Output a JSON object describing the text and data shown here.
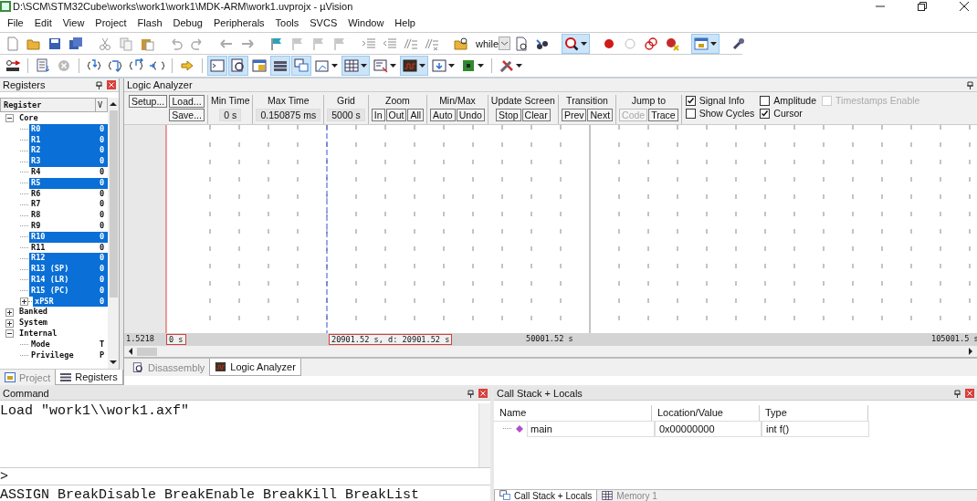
{
  "window": {
    "title": "D:\\SCM\\STM32Cube\\works\\work1\\work1\\MDK-ARM\\work1.uvprojx - µVision"
  },
  "menu": [
    "File",
    "Edit",
    "View",
    "Project",
    "Flash",
    "Debug",
    "Peripherals",
    "Tools",
    "SVCS",
    "Window",
    "Help"
  ],
  "toolbar_1": [
    {
      "kind": "new-file",
      "pressed": false
    },
    {
      "kind": "open",
      "pressed": false
    },
    {
      "kind": "save",
      "pressed": false
    },
    {
      "kind": "save-all",
      "pressed": false
    },
    {
      "kind": "separator"
    },
    {
      "kind": "cut",
      "pressed": false
    },
    {
      "kind": "copy",
      "pressed": false
    },
    {
      "kind": "paste",
      "pressed": false
    },
    {
      "kind": "separator"
    },
    {
      "kind": "undo",
      "pressed": false
    },
    {
      "kind": "redo",
      "pressed": false
    },
    {
      "kind": "separator"
    },
    {
      "kind": "back",
      "pressed": false
    },
    {
      "kind": "forward",
      "pressed": false
    },
    {
      "kind": "separator"
    },
    {
      "kind": "bookmark",
      "pressed": false
    },
    {
      "kind": "bookmark-grey",
      "pressed": false
    },
    {
      "kind": "bookmark-grey",
      "pressed": false
    },
    {
      "kind": "bookmark-grey",
      "pressed": false
    },
    {
      "kind": "separator"
    },
    {
      "kind": "indent",
      "pressed": false
    },
    {
      "kind": "unindent",
      "pressed": false
    },
    {
      "kind": "comment",
      "pressed": false
    },
    {
      "kind": "uncomment",
      "pressed": false
    },
    {
      "kind": "separator"
    },
    {
      "kind": "find-folder",
      "pressed": false
    },
    {
      "kind": "search-box",
      "value": "while"
    },
    {
      "kind": "find-doc",
      "pressed": false
    },
    {
      "kind": "find-binoculars",
      "pressed": false
    },
    {
      "kind": "separator"
    },
    {
      "kind": "debug",
      "pressed": true,
      "dropdown": true
    },
    {
      "kind": "separator"
    },
    {
      "kind": "breakpoint",
      "pressed": false
    },
    {
      "kind": "breakpoint-empty",
      "pressed": false
    },
    {
      "kind": "breakpoint-multi",
      "pressed": false
    },
    {
      "kind": "breakpoint-kill",
      "pressed": false
    },
    {
      "kind": "separator"
    },
    {
      "kind": "window",
      "pressed": true,
      "dropdown": true
    },
    {
      "kind": "separator"
    },
    {
      "kind": "wrench",
      "pressed": false
    }
  ],
  "toolbar_2": [
    {
      "kind": "reset",
      "pressed": false
    },
    {
      "kind": "separator"
    },
    {
      "kind": "run",
      "pressed": false
    },
    {
      "kind": "stop",
      "pressed": false
    },
    {
      "kind": "separator"
    },
    {
      "kind": "step-into",
      "pressed": false
    },
    {
      "kind": "step-over",
      "pressed": false
    },
    {
      "kind": "step-out",
      "pressed": false
    },
    {
      "kind": "run-to",
      "pressed": false
    },
    {
      "kind": "separator"
    },
    {
      "kind": "next-statement",
      "pressed": false
    },
    {
      "kind": "separator"
    },
    {
      "kind": "console",
      "pressed": true
    },
    {
      "kind": "disassembly",
      "pressed": true
    },
    {
      "kind": "symbols",
      "pressed": false
    },
    {
      "kind": "registers",
      "pressed": true
    },
    {
      "kind": "call-stack",
      "pressed": true
    },
    {
      "kind": "watch",
      "pressed": false,
      "dropdown": true
    },
    {
      "kind": "memory",
      "pressed": true,
      "dropdown": true
    },
    {
      "kind": "serial",
      "pressed": false,
      "dropdown": true
    },
    {
      "kind": "analyzer",
      "pressed": true,
      "dropdown": true
    },
    {
      "kind": "trace",
      "pressed": false,
      "dropdown": true
    },
    {
      "kind": "chip",
      "pressed": false,
      "dropdown": true
    },
    {
      "kind": "separator"
    },
    {
      "kind": "tools",
      "pressed": false,
      "dropdown": true
    }
  ],
  "registers": {
    "title": "Registers",
    "columns": [
      "Register",
      "V"
    ],
    "tree": [
      {
        "name": "Core",
        "expanded": true,
        "children": [
          {
            "name": "R0",
            "value": "0",
            "selected": true
          },
          {
            "name": "R1",
            "value": "0",
            "selected": true
          },
          {
            "name": "R2",
            "value": "0",
            "selected": true
          },
          {
            "name": "R3",
            "value": "0",
            "selected": true
          },
          {
            "name": "R4",
            "value": "0",
            "selected": false
          },
          {
            "name": "R5",
            "value": "0",
            "selected": true
          },
          {
            "name": "R6",
            "value": "0",
            "selected": false
          },
          {
            "name": "R7",
            "value": "0",
            "selected": false
          },
          {
            "name": "R8",
            "value": "0",
            "selected": false
          },
          {
            "name": "R9",
            "value": "0",
            "selected": false
          },
          {
            "name": "R10",
            "value": "0",
            "selected": true
          },
          {
            "name": "R11",
            "value": "0",
            "selected": false
          },
          {
            "name": "R12",
            "value": "0",
            "selected": true
          },
          {
            "name": "R13 (SP)",
            "value": "0",
            "selected": true
          },
          {
            "name": "R14 (LR)",
            "value": "0",
            "selected": true
          },
          {
            "name": "R15 (PC)",
            "value": "0",
            "selected": true
          },
          {
            "name": "xPSR",
            "value": "0",
            "selected": true,
            "expanded": false
          }
        ]
      },
      {
        "name": "Banked",
        "expanded": false
      },
      {
        "name": "System",
        "expanded": false
      },
      {
        "name": "Internal",
        "expanded": true,
        "children": [
          {
            "name": "Mode",
            "value": "T",
            "selected": false
          },
          {
            "name": "Privilege",
            "value": "P",
            "selected": false
          }
        ]
      }
    ],
    "tabs": [
      {
        "label": "Project",
        "selected": false
      },
      {
        "label": "Registers",
        "selected": true
      }
    ]
  },
  "logic_analyzer": {
    "title": "Logic Analyzer",
    "file_buttons": [
      "Setup...",
      "Load...",
      "Save..."
    ],
    "groups": [
      {
        "label": "Min Time",
        "kind": "readout",
        "value": "0 s"
      },
      {
        "label": "Max Time",
        "kind": "readout",
        "value": "0.150875 ms"
      },
      {
        "label": "Grid",
        "kind": "readout",
        "value": "5000 s"
      },
      {
        "label": "Zoom",
        "kind": "buttons",
        "buttons": [
          {
            "label": "In",
            "disabled": false
          },
          {
            "label": "Out",
            "disabled": false
          },
          {
            "label": "All",
            "disabled": false
          }
        ]
      },
      {
        "label": "Min/Max",
        "kind": "buttons",
        "buttons": [
          {
            "label": "Auto",
            "disabled": false
          },
          {
            "label": "Undo",
            "disabled": false
          }
        ]
      },
      {
        "label": "Update Screen",
        "kind": "buttons",
        "buttons": [
          {
            "label": "Stop",
            "disabled": false
          },
          {
            "label": "Clear",
            "disabled": false
          }
        ]
      },
      {
        "label": "Transition",
        "kind": "buttons",
        "buttons": [
          {
            "label": "Prev",
            "disabled": false
          },
          {
            "label": "Next",
            "disabled": false
          }
        ]
      },
      {
        "label": "Jump to",
        "kind": "buttons",
        "buttons": [
          {
            "label": "Code",
            "disabled": true
          },
          {
            "label": "Trace",
            "disabled": false
          }
        ]
      }
    ],
    "options": [
      {
        "label": "Signal Info",
        "checked": true,
        "disabled": false
      },
      {
        "label": "Amplitude",
        "checked": false,
        "disabled": false
      },
      {
        "label": "Timestamps Enable",
        "checked": false,
        "disabled": true
      },
      {
        "label": "Show Cycles",
        "checked": false,
        "disabled": false
      },
      {
        "label": "Cursor",
        "checked": true,
        "disabled": false
      }
    ],
    "axis": {
      "start": "1.5218",
      "origin": "0 s",
      "cursor": "20901.52 s,  d: 20901.52 s",
      "middle": "50001.52 s",
      "end": "105001.5 s"
    },
    "tabs": [
      {
        "label": "Disassembly",
        "selected": false
      },
      {
        "label": "Logic Analyzer",
        "selected": true
      }
    ]
  },
  "command": {
    "title": "Command",
    "output": "Load \"work1\\\\work1.axf\"",
    "prompt": ">",
    "hint": "ASSIGN BreakDisable BreakEnable BreakKill BreakList"
  },
  "call_stack": {
    "title": "Call Stack + Locals",
    "columns": [
      "Name",
      "Location/Value",
      "Type"
    ],
    "rows": [
      {
        "name": "main",
        "location": "0x00000000",
        "type": "int f()"
      }
    ],
    "tabs": [
      {
        "label": "Call Stack + Locals",
        "selected": true
      },
      {
        "label": "Memory 1",
        "selected": false
      }
    ]
  }
}
